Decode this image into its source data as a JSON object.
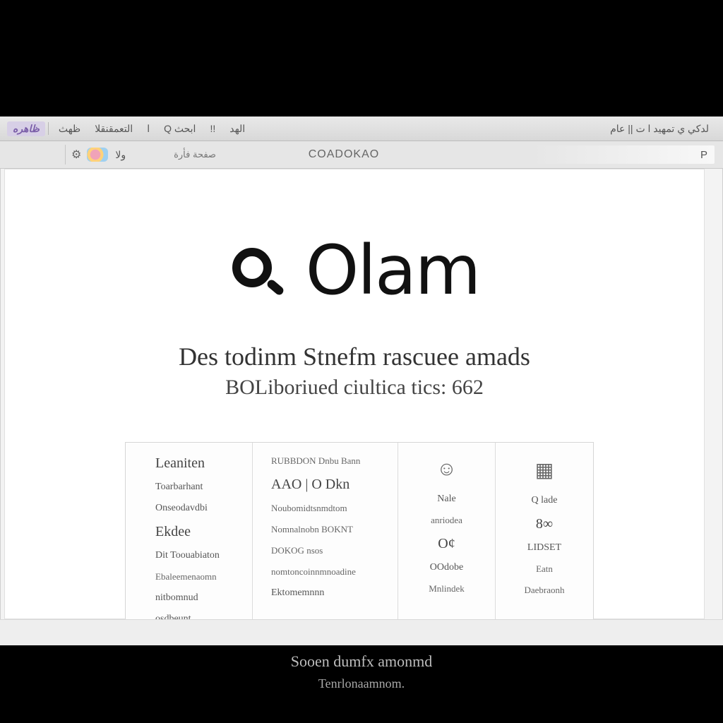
{
  "titlebar": {
    "app_chip": "ظاهره",
    "segments": [
      "ظهث",
      "التعمقنقلا",
      "ا",
      "Q ابحث",
      "!!",
      "الهد"
    ],
    "right": "لدكي ي تمهيد  ا ت || عام"
  },
  "toolbar": {
    "gear_glyph": "⚙",
    "nav_label": "ولا",
    "tab_label": "صفحة فأرة",
    "url_text": "COADOKAO",
    "field_text": "P"
  },
  "hero": {
    "brand": "Olam"
  },
  "tagline": {
    "line1": "Des todinm Stnefm rascuee amads",
    "line2": "BOLiboriued ciultica tics: 662"
  },
  "cards": [
    {
      "lines": [
        "Leaniten",
        "Toarbarhant",
        "Onseodavdbi",
        "Ekdee",
        "Dit Toouabiaton",
        "Ebaleemenaomn",
        "nitbomnud",
        "osdbeunt"
      ]
    },
    {
      "lines": [
        "RUBBDON Dnbu Bann",
        "AAO | O Dkn",
        "Noubomidtsnmdtom",
        "Nomnalnobn BOKNT",
        "DOKOG nsos",
        "nomtoncoinnmnoadine",
        "Ektomemnnn"
      ]
    },
    {
      "icon": "☺",
      "lines": [
        "Nale",
        "anriodea",
        "O¢",
        "OOdobe",
        "Mnlindek"
      ]
    },
    {
      "icon": "▦",
      "lines": [
        "Q lade",
        "8∞",
        "LIDSET",
        "Eatn",
        "Daebraonh"
      ]
    }
  ],
  "caption": {
    "line1": "Sooen dumfx amonmd",
    "line2": "Tenrlonaamnom."
  }
}
